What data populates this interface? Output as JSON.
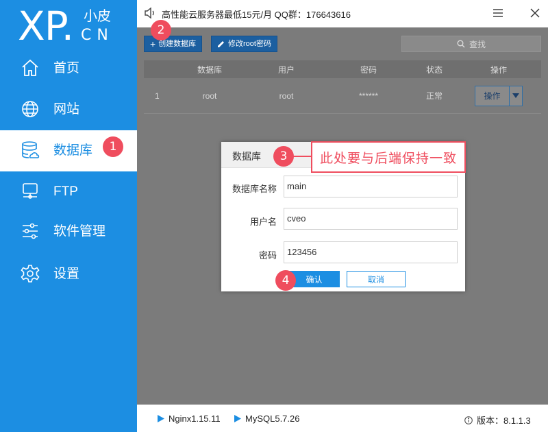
{
  "logo": {
    "main": "XP.",
    "cn_top": "小皮",
    "cn_bottom": "CN"
  },
  "sidebar": {
    "items": [
      {
        "label": "首页",
        "icon": "home-icon"
      },
      {
        "label": "网站",
        "icon": "globe-icon"
      },
      {
        "label": "数据库",
        "icon": "database-icon",
        "active": true
      },
      {
        "label": "FTP",
        "icon": "server-icon"
      },
      {
        "label": "软件管理",
        "icon": "sliders-icon"
      },
      {
        "label": "设置",
        "icon": "gear-icon"
      }
    ]
  },
  "topbar": {
    "notice": "高性能云服务器最低15元/月  QQ群：176643616"
  },
  "toolbar": {
    "create_label": "创建数据库",
    "change_pw_label": "修改root密码",
    "search_placeholder": "查找"
  },
  "table": {
    "headers": [
      "",
      "数据库",
      "用户",
      "密码",
      "状态",
      "操作"
    ],
    "rows": [
      {
        "index": "1",
        "database": "root",
        "user": "root",
        "password": "******",
        "status": "正常",
        "action": "操作"
      }
    ]
  },
  "dialog": {
    "title": "数据库",
    "fields": [
      {
        "label": "数据库名称",
        "value": "main"
      },
      {
        "label": "用户名",
        "value": "cveo"
      },
      {
        "label": "密码",
        "value": "123456"
      }
    ],
    "confirm_label": "确认",
    "cancel_label": "取消"
  },
  "annotations": {
    "badge1": "1",
    "badge2": "2",
    "badge3": "3",
    "badge4": "4",
    "callout": "此处要与后端保持一致"
  },
  "bottombar": {
    "nginx": "Nginx1.15.11",
    "mysql": "MySQL5.7.26",
    "version": "版本：8.1.1.3"
  },
  "colors": {
    "accent": "#1c8ee2",
    "annotation": "#ef4d5e"
  }
}
